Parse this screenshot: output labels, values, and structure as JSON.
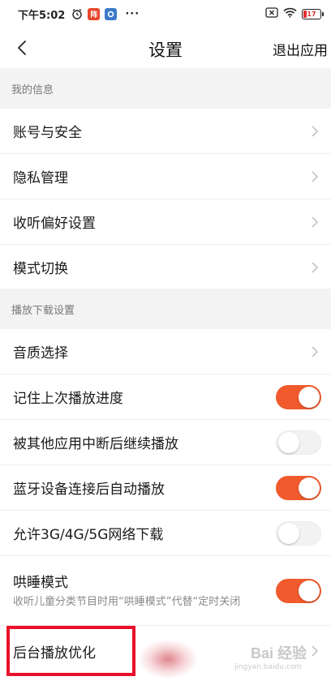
{
  "status_bar": {
    "time": "下午5:02",
    "icons": [
      "alarm-icon",
      "app-red-badge-icon",
      "app-blue-badge-icon",
      "more-dots-icon"
    ],
    "app_badge_red_text": "阵",
    "more": "···",
    "right_icons": [
      "sim-x-icon",
      "wifi-icon"
    ],
    "battery_level": "17"
  },
  "navbar": {
    "back_icon": "chevron-left-icon",
    "title": "设置",
    "exit_label": "退出应用"
  },
  "sections": {
    "my_info": {
      "header": "我的信息",
      "rows": [
        {
          "label": "账号与安全"
        },
        {
          "label": "隐私管理"
        },
        {
          "label": "收听偏好设置"
        },
        {
          "label": "模式切换"
        }
      ]
    },
    "playback": {
      "header": "播放下载设置",
      "rows": [
        {
          "label": "音质选择"
        },
        {
          "label": "记住上次播放进度",
          "toggle": "on"
        },
        {
          "label": "被其他应用中断后继续播放",
          "toggle": "off"
        },
        {
          "label": "蓝牙设备连接后自动播放",
          "toggle": "on"
        },
        {
          "label": "允许3G/4G/5G网络下载",
          "toggle": "off"
        },
        {
          "label": "哄睡模式",
          "sub": "收听儿童分类节目时用“哄睡模式”代替“定时关闭",
          "toggle": "on"
        },
        {
          "label": "后台播放优化"
        }
      ]
    }
  },
  "colors": {
    "accent": "#f05a2c",
    "section_bg": "#f3f3f3",
    "highlight": "#e8102a"
  },
  "watermark": {
    "text": "Bai 经验",
    "sub": "jingyan.baidu.com"
  }
}
